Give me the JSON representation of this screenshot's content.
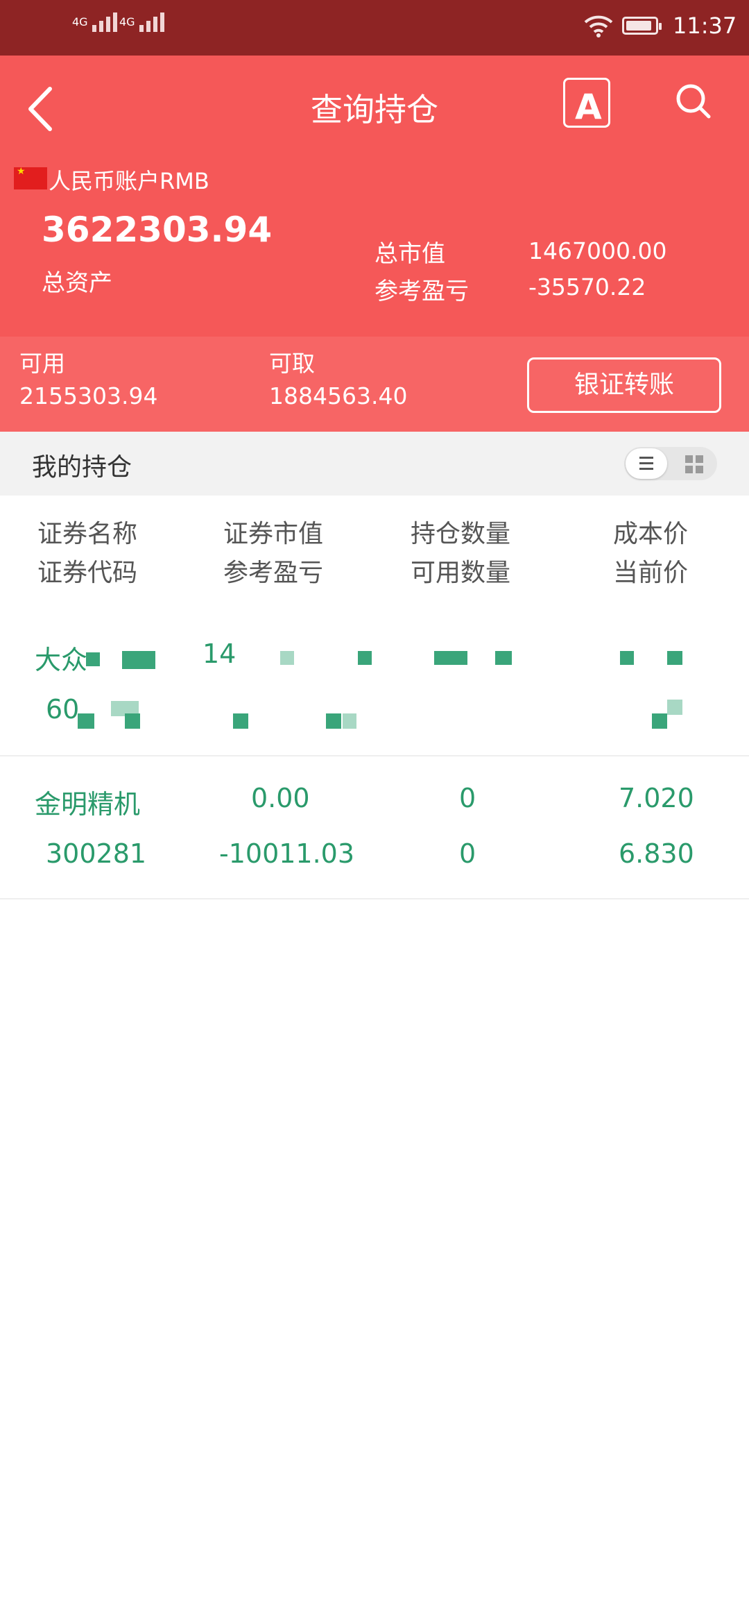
{
  "status": {
    "signal1": "4G",
    "signal2": "4G",
    "time": "11:37"
  },
  "header": {
    "title": "查询持仓",
    "font_button": "A",
    "account_label": "人民币账户RMB",
    "total_assets_value": "3622303.94",
    "total_assets_label": "总资产",
    "market_value_label": "总市值",
    "market_value": "1467000.00",
    "profit_label": "参考盈亏",
    "profit_value": "-35570.22"
  },
  "funds": {
    "available_label": "可用",
    "available_value": "2155303.94",
    "withdrawable_label": "可取",
    "withdrawable_value": "1884563.40",
    "transfer_button": "银证转账"
  },
  "section": {
    "title": "我的持仓"
  },
  "columns": {
    "c1_top": "证券名称",
    "c1_bottom": "证券代码",
    "c2_top": "证券市值",
    "c2_bottom": "参考盈亏",
    "c3_top": "持仓数量",
    "c3_bottom": "可用数量",
    "c4_top": "成本价",
    "c4_bottom": "当前价"
  },
  "holdings": [
    {
      "name": "大众",
      "code": "60",
      "market_value": "14",
      "profit": "",
      "qty": "",
      "avail_qty": "",
      "cost": "",
      "price": ""
    },
    {
      "name": "金明精机",
      "code": "300281",
      "market_value": "0.00",
      "profit": "-10011.03",
      "qty": "0",
      "avail_qty": "0",
      "cost": "7.020",
      "price": "6.830"
    }
  ],
  "colors": {
    "header": "#f55858",
    "subbar": "#f76565",
    "statusbar": "#8e2424",
    "stock_text": "#2a9a6b"
  }
}
